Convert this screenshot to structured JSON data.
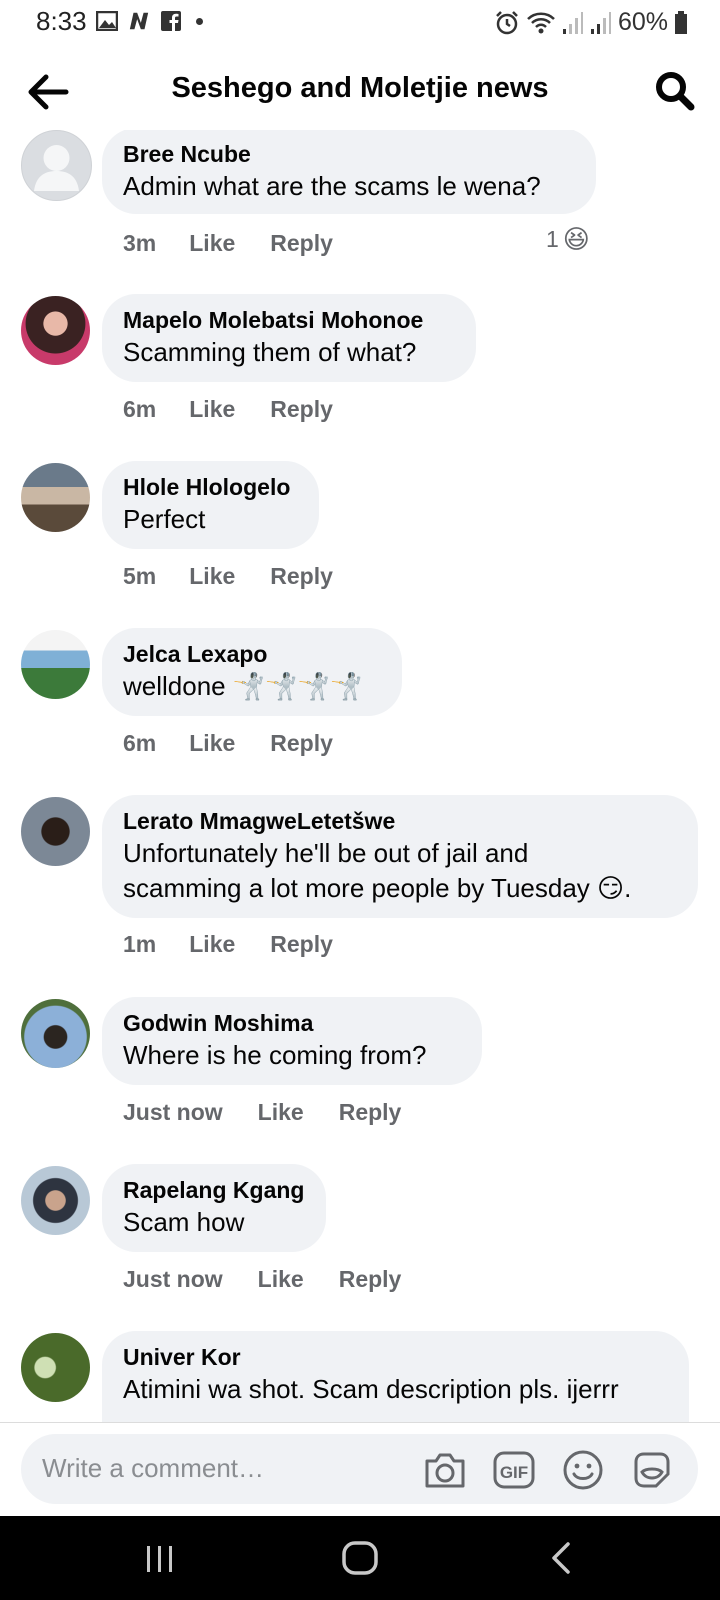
{
  "status_bar": {
    "time": "8:33",
    "battery": "60%"
  },
  "header": {
    "title": "Seshego and Moletjie news"
  },
  "comments": [
    {
      "author": "Bree Ncube",
      "lines": [
        "Admin what are the scams le wena?"
      ],
      "time": "3m",
      "like": "Like",
      "reply": "Reply",
      "reaction_count": "1",
      "reaction_emoji": "😆"
    },
    {
      "author": "Mapelo Molebatsi Mohonoe",
      "lines": [
        "Scamming them of what?"
      ],
      "time": "6m",
      "like": "Like",
      "reply": "Reply"
    },
    {
      "author": "Hlole Hlologelo",
      "lines": [
        "Perfect"
      ],
      "time": "5m",
      "like": "Like",
      "reply": "Reply"
    },
    {
      "author": "Jelca Lexapo",
      "lines": [
        "welldone 🤺🤺🤺🤺"
      ],
      "time": "6m",
      "like": "Like",
      "reply": "Reply"
    },
    {
      "author": "Lerato MmagweLetetšwe",
      "lines": [
        "Unfortunately he'll be out of jail and",
        "scamming a lot more people by Tuesday 😏."
      ],
      "time": "1m",
      "like": "Like",
      "reply": "Reply"
    },
    {
      "author": "Godwin Moshima",
      "lines": [
        "Where is he coming from?"
      ],
      "time": "Just now",
      "like": "Like",
      "reply": "Reply"
    },
    {
      "author": "Rapelang Kgang",
      "lines": [
        "Scam how"
      ],
      "time": "Just now",
      "like": "Like",
      "reply": "Reply"
    },
    {
      "author": "Univer Kor",
      "lines": [
        "Atimini wa shot. Scam description pls. ijerrr"
      ]
    }
  ],
  "composer": {
    "placeholder": "Write a comment…",
    "icons": [
      "camera-icon",
      "gif-icon",
      "emoji-icon",
      "sticker-icon"
    ]
  },
  "navbar": {
    "icons": [
      "recent-apps-icon",
      "home-icon",
      "back-icon"
    ]
  },
  "colors": {
    "bubble": "#f0f2f5",
    "secondary_text": "#65676b",
    "primary_text": "#050505"
  }
}
